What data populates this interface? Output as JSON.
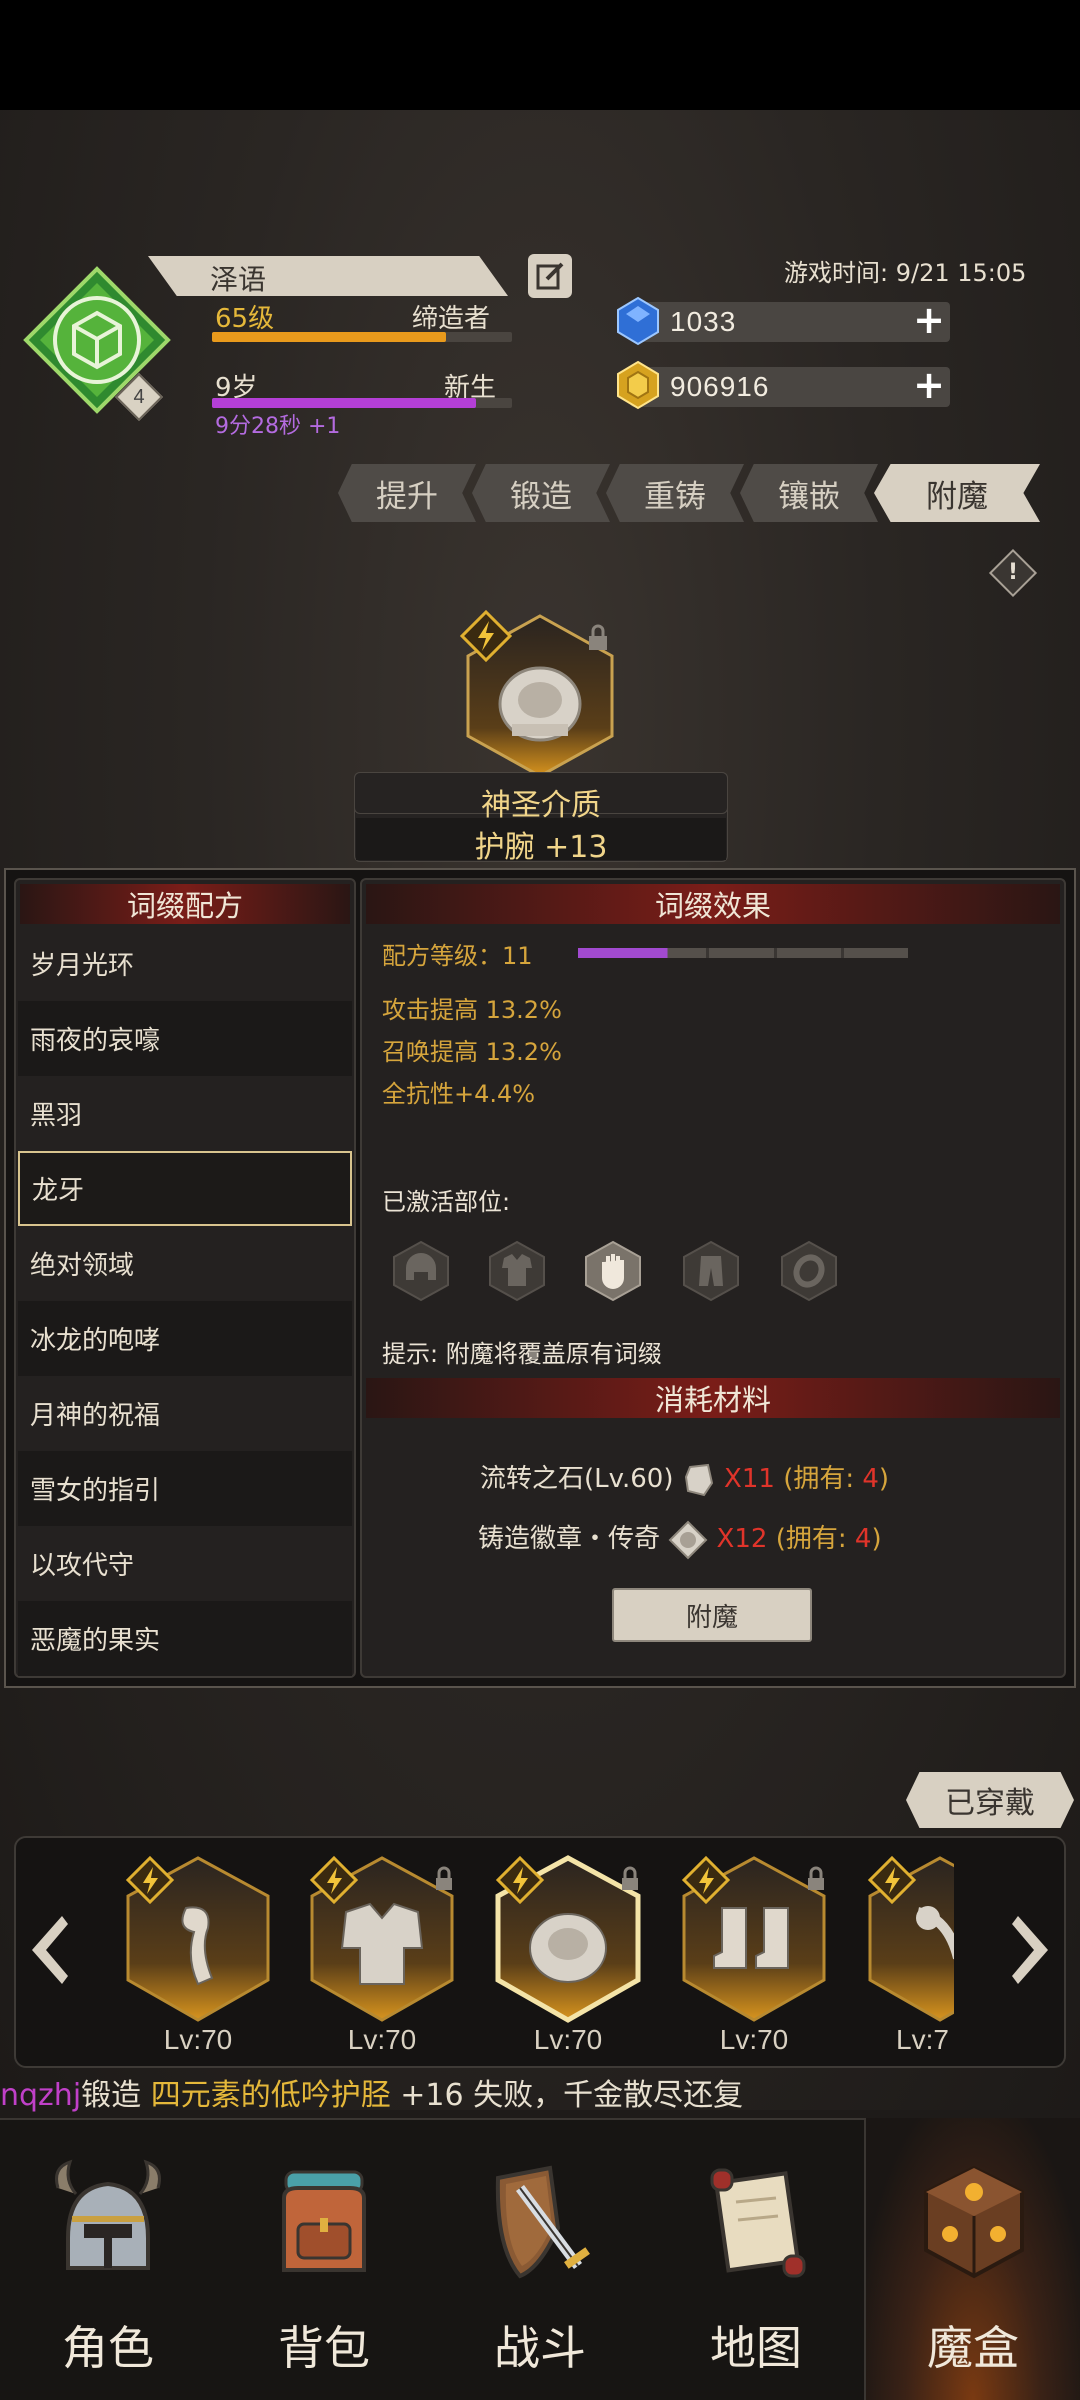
{
  "player": {
    "name": "泽语",
    "level": "65级",
    "title": "缔造者",
    "age": "9岁",
    "stage": "新生",
    "timer": "9分28秒 +1",
    "emblem_badge": "4",
    "exp_progress": 0.78,
    "age_progress": 0.88
  },
  "game_time": "游戏时间: 9/21 15:05",
  "currency": {
    "gems": "1033",
    "gold": "906916"
  },
  "tabs": [
    "提升",
    "锻造",
    "重铸",
    "镶嵌",
    "附魔"
  ],
  "active_tab": "附魔",
  "featured_item": {
    "name": "神圣介质",
    "sub": "护腕 +13"
  },
  "affix_recipe": {
    "header": "词缀配方",
    "items": [
      "岁月光环",
      "雨夜的哀嚎",
      "黑羽",
      "龙牙",
      "绝对领域",
      "冰龙的咆哮",
      "月神的祝福",
      "雪女的指引",
      "以攻代守",
      "恶魔的果实"
    ],
    "selected": "龙牙"
  },
  "affix_effect": {
    "header": "词缀效果",
    "recipe_level_label": "配方等级：11",
    "recipe_level_progress": 0.28,
    "stats": [
      "攻击提高 13.2%",
      "召唤提高 13.2%",
      "全抗性+4.4%"
    ],
    "activated_label": "已激活部位:",
    "slot_icons": [
      "helmet-slot-icon",
      "armor-slot-icon",
      "glove-slot-icon",
      "pants-slot-icon",
      "ring-slot-icon"
    ],
    "tip": "提示: 附魔将覆盖原有词缀"
  },
  "materials": {
    "header": "消耗材料",
    "rows": [
      {
        "name": "流转之石(Lv.60)",
        "qty": "X11",
        "own_prefix": "(拥有: ",
        "own": "4",
        "own_suffix": ")"
      },
      {
        "name": "铸造徽章・传奇",
        "qty": "X12",
        "own_prefix": "(拥有: ",
        "own": "4",
        "own_suffix": ")"
      }
    ],
    "button": "附魔"
  },
  "equipped_button": "已穿戴",
  "equipment": [
    {
      "lv": "Lv:70"
    },
    {
      "lv": "Lv:70"
    },
    {
      "lv": "Lv:70"
    },
    {
      "lv": "Lv:70"
    },
    {
      "lv": "Lv:7"
    }
  ],
  "ticker": {
    "user": "nqzhj",
    "action": "锻造 ",
    "item": "四元素的低吟护胫",
    "rest": " +16 失败，千金散尽还复"
  },
  "nav": [
    "角色",
    "背包",
    "战斗",
    "地图",
    "魔盒"
  ],
  "active_nav": "魔盒",
  "colors": {
    "accent_gold": "#d6a53c",
    "purple": "#a24ad0",
    "header_red": "#7a1d18"
  }
}
